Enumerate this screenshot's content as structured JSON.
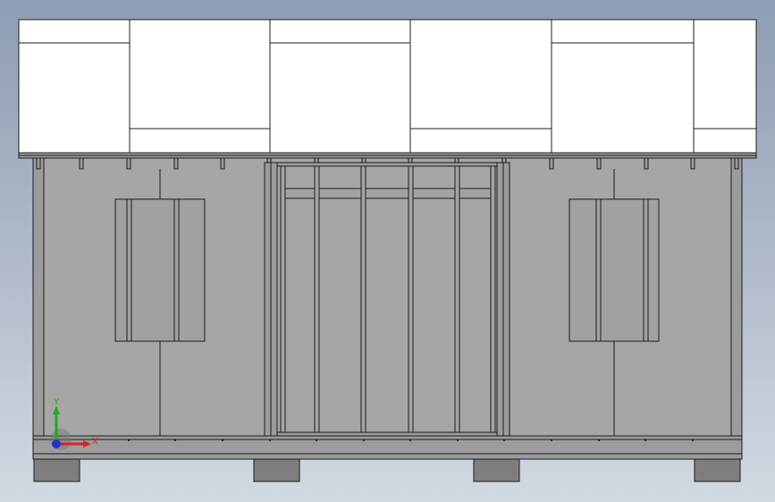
{
  "viewport": {
    "background_top": "#8e9db3",
    "background_bottom": "#d3d9e2",
    "model_colors": {
      "roof": "#ffffff",
      "wall_panel": "#a6a6a6",
      "feet": "#7e7e7e",
      "edges": "#1c1c1c"
    }
  },
  "triad": {
    "y_label": "Y",
    "x_label": "X",
    "y_color": "#22aa22",
    "x_color": "#dd2222",
    "z_color": "#2233cc"
  }
}
